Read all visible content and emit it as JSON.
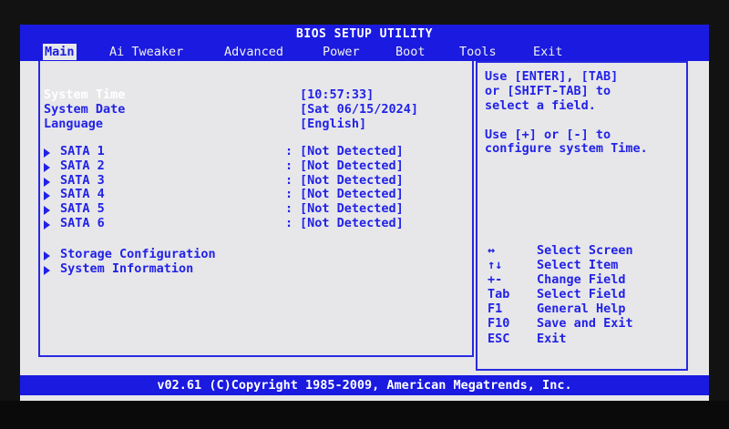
{
  "header": {
    "title": "BIOS SETUP UTILITY"
  },
  "menu": {
    "tabs": [
      {
        "label": "Main"
      },
      {
        "label": "Ai Tweaker"
      },
      {
        "label": "Advanced"
      },
      {
        "label": "Power"
      },
      {
        "label": "Boot"
      },
      {
        "label": "Tools"
      },
      {
        "label": "Exit"
      }
    ]
  },
  "main": {
    "system_time": {
      "label": "System Time",
      "value": "[10:57:33]"
    },
    "system_date": {
      "label": "System Date",
      "value": "[Sat 06/15/2024]"
    },
    "language": {
      "label": "Language",
      "value": "[English]"
    },
    "sata": [
      {
        "label": "SATA 1",
        "value": "[Not Detected]"
      },
      {
        "label": "SATA 2",
        "value": "[Not Detected]"
      },
      {
        "label": "SATA 3",
        "value": "[Not Detected]"
      },
      {
        "label": "SATA 4",
        "value": "[Not Detected]"
      },
      {
        "label": "SATA 5",
        "value": "[Not Detected]"
      },
      {
        "label": "SATA 6",
        "value": "[Not Detected]"
      }
    ],
    "separator": ":",
    "submenus": [
      {
        "label": "Storage Configuration"
      },
      {
        "label": "System Information"
      }
    ]
  },
  "help": {
    "lines": [
      "Use [ENTER], [TAB]",
      "or [SHIFT-TAB] to",
      "select a field.",
      "Use [+] or [-] to",
      "configure system Time."
    ],
    "keys": [
      {
        "key": "↔",
        "desc": "Select Screen"
      },
      {
        "key": "↑↓",
        "desc": "Select Item"
      },
      {
        "key": "+-",
        "desc": "Change Field"
      },
      {
        "key": "Tab",
        "desc": "Select Field"
      },
      {
        "key": "F1",
        "desc": "General Help"
      },
      {
        "key": "F10",
        "desc": "Save and Exit"
      },
      {
        "key": "ESC",
        "desc": "Exit"
      }
    ]
  },
  "footer": {
    "text": "v02.61 (C)Copyright 1985-2009, American Megatrends, Inc."
  },
  "colors": {
    "accent": "#1a1ae0",
    "background": "#e7e7ea",
    "text": "#2222e6",
    "highlight": "#ffffff"
  }
}
